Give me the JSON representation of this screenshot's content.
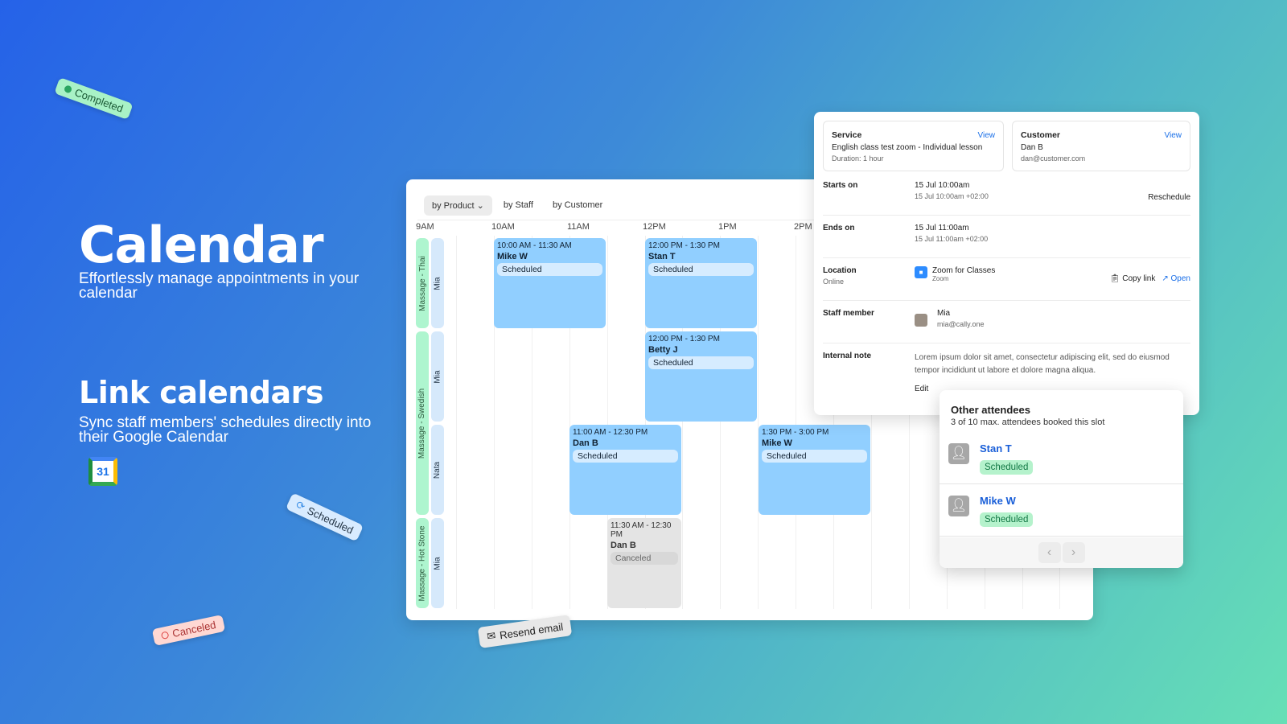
{
  "hero": {
    "title": "Calendar",
    "subtitle": "Effortlessly manage appointments in your calendar",
    "title2": "Link calendars",
    "subtitle2": "Sync staff members' schedules directly into their Google Calendar",
    "gcal_day": "31"
  },
  "stickers": {
    "completed": "Completed",
    "scheduled": "Scheduled",
    "canceled": "Canceled",
    "resend": "Resend email"
  },
  "colors": {
    "scheduled": "#91cfff",
    "canceled": "#e4e4e4",
    "product": "#aef5cf",
    "staff": "#d6e9fb",
    "link": "#1a6fe8"
  },
  "calendar": {
    "tabs": [
      {
        "label": "by Product ⌄",
        "active": true
      },
      {
        "label": "by Staff"
      },
      {
        "label": "by Customer"
      }
    ],
    "hours": [
      "9AM",
      "10AM",
      "11AM",
      "12PM",
      "1PM",
      "2PM"
    ],
    "products": [
      "Massage - Thai",
      "Massage - Swedish",
      "Massage - Hot Stone"
    ],
    "staff_rows": [
      "Mia",
      "Mia",
      "Nata",
      "Mia"
    ],
    "events": [
      {
        "time": "10:00 AM - 11:30 AM",
        "name": "Mike W",
        "status": "Scheduled",
        "row": 0,
        "start": 10,
        "end": 11.5
      },
      {
        "time": "12:00 PM - 1:30 PM",
        "name": "Stan T",
        "status": "Scheduled",
        "row": 0,
        "start": 12,
        "end": 13.5
      },
      {
        "time": "12:00 PM - 1:30 PM",
        "name": "Betty J",
        "status": "Scheduled",
        "row": 1,
        "start": 12,
        "end": 13.5
      },
      {
        "time": "11:00 AM - 12:30 PM",
        "name": "Dan B",
        "status": "Scheduled",
        "row": 2,
        "start": 11,
        "end": 12.5
      },
      {
        "time": "1:30 PM - 3:00 PM",
        "name": "Mike W",
        "status": "Scheduled",
        "row": 2,
        "start": 13.5,
        "end": 15
      },
      {
        "time": "11:30 AM - 12:30 PM",
        "name": "Dan B",
        "status": "Canceled",
        "row": 3,
        "start": 11.5,
        "end": 12.5
      }
    ]
  },
  "detail": {
    "service": {
      "label": "Service",
      "view": "View",
      "name": "English class test zoom - Individual lesson",
      "duration": "Duration: 1 hour"
    },
    "customer": {
      "label": "Customer",
      "view": "View",
      "name": "Dan B",
      "email": "dan@customer.com"
    },
    "starts": {
      "label": "Starts on",
      "value": "15 Jul 10:00am",
      "sub": "15 Jul 10:00am +02:00",
      "action": "Reschedule"
    },
    "ends": {
      "label": "Ends on",
      "value": "15 Jul 11:00am",
      "sub": "15 Jul 11:00am +02:00"
    },
    "location": {
      "label": "Location",
      "sub": "Online",
      "name": "Zoom for Classes",
      "provider": "Zoom",
      "copy": "Copy link",
      "open": "Open"
    },
    "staff": {
      "label": "Staff member",
      "name": "Mia",
      "email": "mia@cally.one"
    },
    "note": {
      "label": "Internal note",
      "text": "Lorem ipsum dolor sit amet, consectetur adipiscing elit, sed do eiusmod tempor incididunt ut labore et dolore magna aliqua.",
      "edit": "Edit"
    }
  },
  "attendees": {
    "title": "Other attendees",
    "subtitle": "3 of 10 max. attendees booked this slot",
    "items": [
      {
        "name": "Stan T",
        "status": "Scheduled"
      },
      {
        "name": "Mike W",
        "status": "Scheduled"
      }
    ]
  }
}
